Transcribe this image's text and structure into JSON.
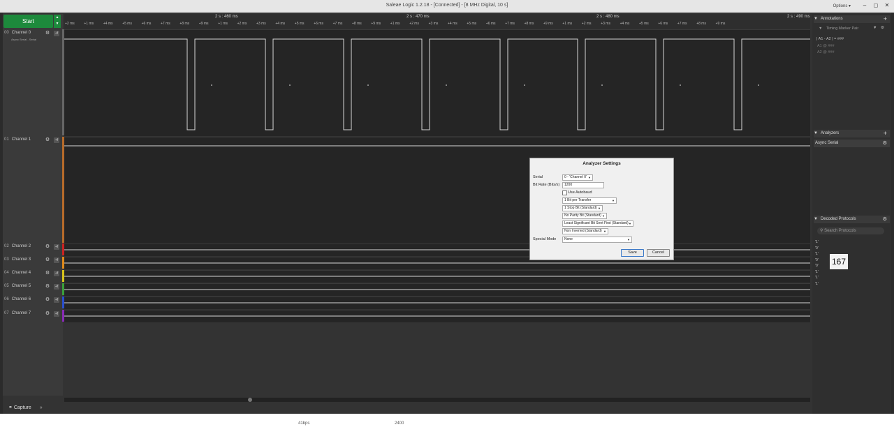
{
  "window": {
    "title": "Saleae Logic 1.2.18 - [Connected] - [8 MHz Digital, 10 s]",
    "options_label": "Options ▾"
  },
  "toolbar": {
    "start_label": "Start"
  },
  "ruler": {
    "major": [
      "2 s : 460 ms",
      "2 s : 470 ms",
      "2 s : 480 ms",
      "2 s : 490 ms"
    ],
    "ticks": [
      "+2 ms",
      "+1 ms",
      "+4 ms",
      "+5 ms",
      "+6 ms",
      "+7 ms",
      "+8 ms",
      "+9 ms",
      "+1 ms",
      "+2 ms",
      "+3 ms",
      "+4 ms",
      "+5 ms",
      "+6 ms",
      "+7 ms",
      "+8 ms",
      "+9 ms",
      "+1 ms",
      "+2 ms",
      "+3 ms",
      "+4 ms",
      "+5 ms",
      "+6 ms",
      "+7 ms",
      "+8 ms",
      "+9 ms",
      "+1 ms",
      "+2 ms",
      "+3 ms",
      "+4 ms",
      "+5 ms",
      "+6 ms",
      "+7 ms",
      "+8 ms",
      "+9 ms"
    ],
    "decoded": [
      "'1'",
      "'0'",
      "'1'",
      "'0'",
      "'0'",
      "'1'",
      "'1'",
      "'1'"
    ]
  },
  "channels": [
    {
      "num": "00",
      "name": "Channel 0",
      "sub": "Async Serial - Serial",
      "color": "#666666"
    },
    {
      "num": "01",
      "name": "Channel 1",
      "color": "#b86b2a"
    },
    {
      "num": "02",
      "name": "Channel 2",
      "color": "#cc2222"
    },
    {
      "num": "03",
      "name": "Channel 3",
      "color": "#e08a1a"
    },
    {
      "num": "04",
      "name": "Channel 4",
      "color": "#d8c41a"
    },
    {
      "num": "05",
      "name": "Channel 5",
      "color": "#3aa03a"
    },
    {
      "num": "06",
      "name": "Channel 6",
      "color": "#2a4fd0"
    },
    {
      "num": "07",
      "name": "Channel 7",
      "color": "#8a2ab8"
    }
  ],
  "bottom": {
    "capture_label": "Capture"
  },
  "status": {
    "left": "41bps",
    "mid": "2400"
  },
  "annotations": {
    "header": "Annotations",
    "marker_pair": "Timing Marker Pair",
    "rows": [
      "| A1 - A2 | = ###",
      "A1  @  ###",
      "A2  @  ###"
    ]
  },
  "analyzers": {
    "header": "Analyzers",
    "items": [
      "Async Serial"
    ]
  },
  "decoded_protocols": {
    "header": "Decoded Protocols",
    "search_placeholder": "Search Protocols",
    "items": [
      "'1'",
      "'0'",
      "'1'",
      "'0'",
      "'0'",
      "'1'",
      "'1'",
      "'1'"
    ],
    "count": "167"
  },
  "dialog": {
    "title": "Analyzer Settings",
    "serial_label": "Serial",
    "serial_value": "0 - 'Channel 0'",
    "bitrate_label": "Bit Rate (Bits/s)",
    "bitrate_value": "1200",
    "autobaud_label": "Use Autobaud",
    "bits_value": "1 Bit per Transfer",
    "stop_value": "1 Stop Bit (Standard)",
    "parity_value": "No Parity Bit (Standard)",
    "order_value": "Least Significant Bit Sent First (Standard)",
    "invert_value": "Non Inverted (Standard)",
    "special_label": "Special Mode",
    "special_value": "None",
    "save_label": "Save",
    "cancel_label": "Cancel"
  }
}
